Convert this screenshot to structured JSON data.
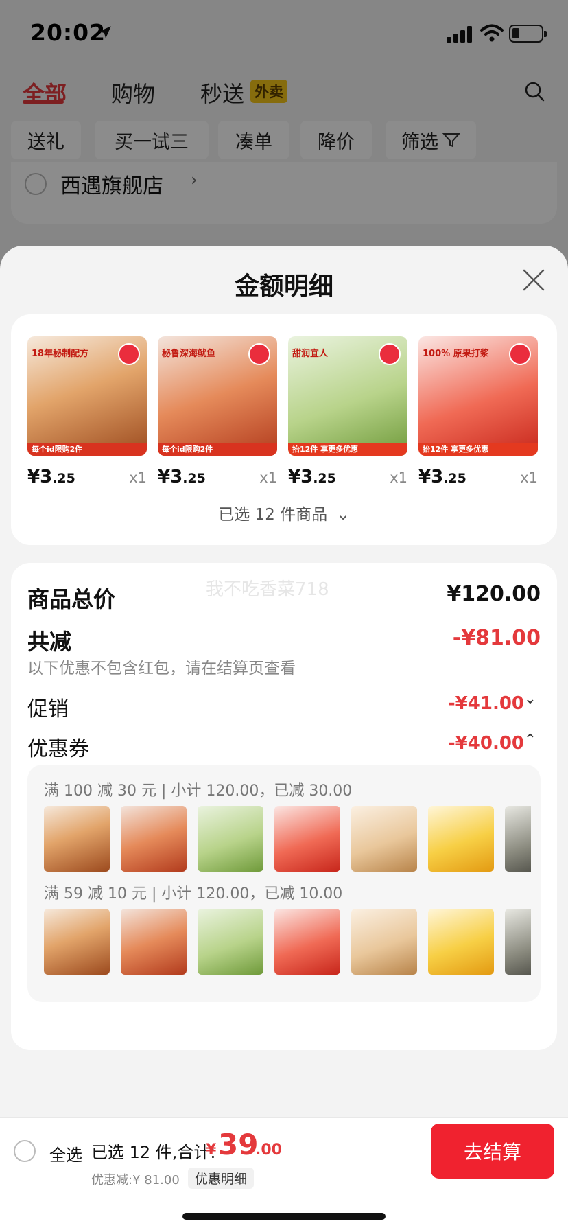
{
  "status_bar": {
    "time": "20:02"
  },
  "top_tabs": [
    {
      "label": "全部",
      "active": true
    },
    {
      "label": "购物",
      "active": false
    },
    {
      "label": "秒送",
      "active": false
    }
  ],
  "waimai_badge": "外卖",
  "filter_chips": [
    "送礼",
    "买一试三",
    "凑单",
    "降价",
    "筛选"
  ],
  "store": {
    "name": "西遇旗舰店"
  },
  "sheet": {
    "title": "金额明细",
    "products": [
      {
        "price_int": "¥3",
        "price_dec": ".25",
        "qty": "x1",
        "img_title": "18年秘制配方",
        "img_banner": "每个id限购2件",
        "img_style": "fish"
      },
      {
        "price_int": "¥3",
        "price_dec": ".25",
        "qty": "x1",
        "img_title": "秘鲁深海鱿鱼",
        "img_banner": "每个id限购2件",
        "img_style": "squid"
      },
      {
        "price_int": "¥3",
        "price_dec": ".25",
        "qty": "x1",
        "img_title": "甜润宜人",
        "img_banner": "抬12件 享更多优惠",
        "img_style": "grape"
      },
      {
        "price_int": "¥3",
        "price_dec": ".25",
        "qty": "x1",
        "img_title": "100% 原果打浆",
        "img_banner": "抬12件 享更多优惠",
        "img_style": "haw"
      }
    ],
    "selected_count": "已选 12 件商品",
    "watermark": "我不吃香菜718",
    "total": {
      "label": "商品总价",
      "value": "¥120.00"
    },
    "reduction": {
      "label": "共减",
      "value": "-¥81.00",
      "note": "以下优惠不包含红包，请在结算页查看"
    },
    "promo": {
      "label": "促销",
      "value": "-¥41.00"
    },
    "coupon": {
      "label": "优惠券",
      "value": "-¥40.00"
    },
    "coupon_rules": [
      {
        "text": "满 100 减 30 元 | 小计 120.00，已减 30.00"
      },
      {
        "text": "满 59 减 10 元 | 小计 120.00，已减 10.00"
      }
    ],
    "thumb_styles": [
      "fish",
      "squid",
      "grape",
      "haw",
      "cup",
      "mango",
      "dark"
    ]
  },
  "bottom_bar": {
    "select_all": "全选",
    "summary": "已选 12 件,合计:",
    "total_yen": "¥",
    "total_int": "39",
    "total_dec": ".00",
    "discount": "优惠减:¥ 81.00",
    "detail_tag": "优惠明细",
    "checkout": "去结算"
  },
  "colors": {
    "accent_red": "#e4393c",
    "button_red": "#f0222f",
    "sheet_bg": "#f3f3f3"
  }
}
